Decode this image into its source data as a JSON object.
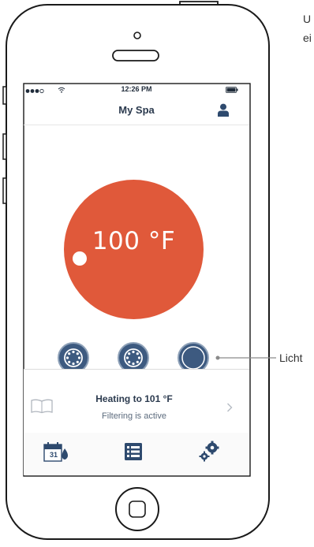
{
  "status_bar": {
    "time": "12:26 PM"
  },
  "header": {
    "title": "My Spa",
    "profile_icon": "person-icon"
  },
  "thermostat": {
    "temperature_label": "100 °F"
  },
  "controls": {
    "buttons": [
      {
        "icon": "jets-icon"
      },
      {
        "icon": "jets-icon"
      },
      {
        "icon": "light-icon"
      }
    ],
    "callout_label": "Licht"
  },
  "status_panel": {
    "heading": "Heating to 101 °F",
    "subtext": "Filtering is active"
  },
  "tab_bar": {
    "items": [
      {
        "icon": "calendar-icon",
        "label": "31"
      },
      {
        "icon": "list-icon"
      },
      {
        "icon": "settings-gears-icon"
      }
    ]
  },
  "annotations": {
    "top_right_text": "U\nei"
  },
  "colors": {
    "accent": "#E0593A",
    "control_blue": "#3D5A80",
    "header_text": "#2B3A4E"
  }
}
